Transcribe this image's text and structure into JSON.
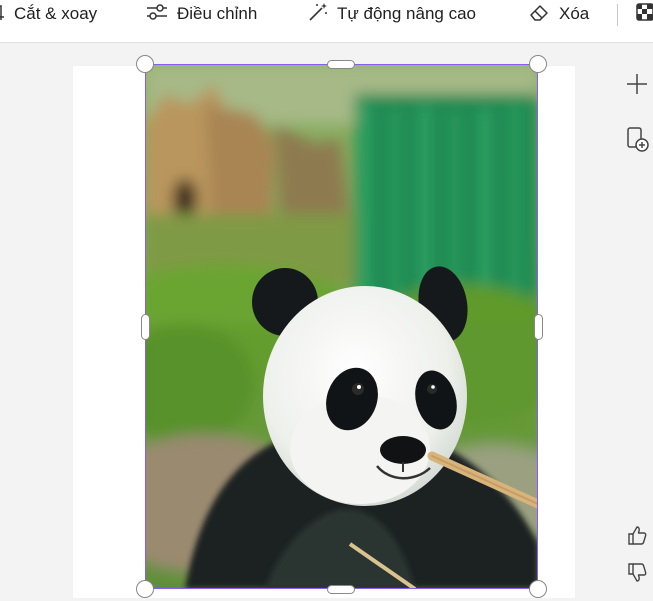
{
  "toolbar": {
    "crop_label": "Cắt & xoay",
    "adjust_label": "Điều chỉnh",
    "auto_label": "Tự động nâng cao",
    "erase_label": "Xóa"
  },
  "colors": {
    "selection": "#8a5cf0",
    "background": "#f3f3f3"
  },
  "icons": {
    "crop": "crop-icon",
    "adjust": "sliders-icon",
    "auto": "magic-wand-icon",
    "erase": "eraser-icon",
    "more": "checkerboard-icon",
    "add": "plus-icon",
    "add_page": "add-page-icon",
    "like": "thumbs-up-icon",
    "dislike": "thumbs-down-icon"
  }
}
